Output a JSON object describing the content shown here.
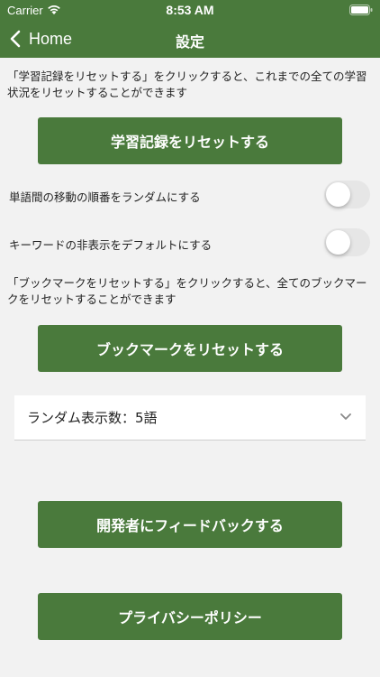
{
  "status_bar": {
    "carrier": "Carrier",
    "time": "8:53 AM"
  },
  "nav": {
    "back_label": "Home",
    "title": "設定"
  },
  "reset_history": {
    "note": "「学習記録をリセットする」をクリックすると、これまでの全ての学習状況をリセットすることができます",
    "button_label": "学習記録をリセットする"
  },
  "toggles": [
    {
      "label": "単語間の移動の順番をランダムにする",
      "on": false
    },
    {
      "label": "キーワードの非表示をデフォルトにする",
      "on": false
    }
  ],
  "reset_bookmarks": {
    "note": "「ブックマークをリセットする」をクリックすると、全てのブックマークをリセットすることができます",
    "button_label": "ブックマークをリセットする"
  },
  "random_count_select": {
    "value": "ランダム表示数：5語"
  },
  "feedback": {
    "button_label": "開発者にフィードバックする"
  },
  "privacy": {
    "button_label": "プライバシーポリシー"
  },
  "colors": {
    "primary_green": "#4a7a3c",
    "background": "#f2f2f2",
    "switch_off": "#e6e6e6"
  }
}
